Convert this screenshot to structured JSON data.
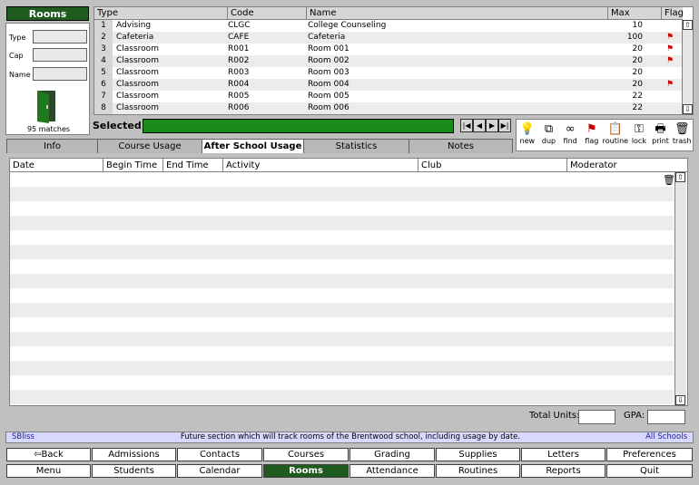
{
  "panel_title": "Rooms",
  "filters": [
    {
      "label": "Type",
      "value": ""
    },
    {
      "label": "Cap",
      "value": ""
    },
    {
      "label": "Name",
      "value": ""
    }
  ],
  "matches_text": "95 matches",
  "table": {
    "columns": [
      "Type",
      "Code",
      "Name",
      "Max",
      "Flag"
    ],
    "rows": [
      {
        "num": "1",
        "type": "Advising",
        "code": "CLGC",
        "name": "College Counseling",
        "max": "10",
        "flag": false
      },
      {
        "num": "2",
        "type": "Cafeteria",
        "code": "CAFE",
        "name": "Cafeteria",
        "max": "100",
        "flag": true
      },
      {
        "num": "3",
        "type": "Classroom",
        "code": "R001",
        "name": "Room 001",
        "max": "20",
        "flag": true
      },
      {
        "num": "4",
        "type": "Classroom",
        "code": "R002",
        "name": "Room 002",
        "max": "20",
        "flag": true
      },
      {
        "num": "5",
        "type": "Classroom",
        "code": "R003",
        "name": "Room 003",
        "max": "20",
        "flag": false
      },
      {
        "num": "6",
        "type": "Classroom",
        "code": "R004",
        "name": "Room 004",
        "max": "20",
        "flag": true
      },
      {
        "num": "7",
        "type": "Classroom",
        "code": "R005",
        "name": "Room 005",
        "max": "22",
        "flag": false
      },
      {
        "num": "8",
        "type": "Classroom",
        "code": "R006",
        "name": "Room 006",
        "max": "22",
        "flag": false
      }
    ]
  },
  "selected_label": "Selected:",
  "toolbar": [
    {
      "label": "new",
      "icon": "lightbulb-icon",
      "glyph": "💡"
    },
    {
      "label": "dup",
      "icon": "duplicate-icon",
      "glyph": "⧉"
    },
    {
      "label": "find",
      "icon": "glasses-icon",
      "glyph": "∞"
    },
    {
      "label": "flag",
      "icon": "flag-icon",
      "glyph": "⚑"
    },
    {
      "label": "routine",
      "icon": "clipboard-icon",
      "glyph": "📋"
    },
    {
      "label": "lock",
      "icon": "key-icon",
      "glyph": "⚿"
    },
    {
      "label": "print",
      "icon": "printer-icon",
      "glyph": "🖶"
    },
    {
      "label": "trash",
      "icon": "trash-icon",
      "glyph": "🗑"
    }
  ],
  "tabs": [
    "Info",
    "Course Usage",
    "After School Usage",
    "Statistics",
    "Notes"
  ],
  "active_tab": "After School Usage",
  "content_columns": [
    "Date",
    "Begin Time",
    "End Time",
    "Activity",
    "Club",
    "Moderator"
  ],
  "totals": {
    "units_label": "Total Units:",
    "gpa_label": "GPA:",
    "units_value": "",
    "gpa_value": ""
  },
  "status": {
    "user": "SBliss",
    "message": "Future section which will track rooms of the Brentwood school, including usage by date.",
    "scope": "All Schools"
  },
  "nav_row1": [
    "Back",
    "Admissions",
    "Contacts",
    "Courses",
    "Grading",
    "Supplies",
    "Letters",
    "Preferences"
  ],
  "nav_row2": [
    "Menu",
    "Students",
    "Calendar",
    "Rooms",
    "Attendance",
    "Routines",
    "Reports",
    "Quit"
  ],
  "colors": {
    "brand_green": "#1f5a1f",
    "selected_green": "#1a8c1a",
    "flag_red": "#cc0000",
    "status_bg": "#d8d8ff"
  }
}
